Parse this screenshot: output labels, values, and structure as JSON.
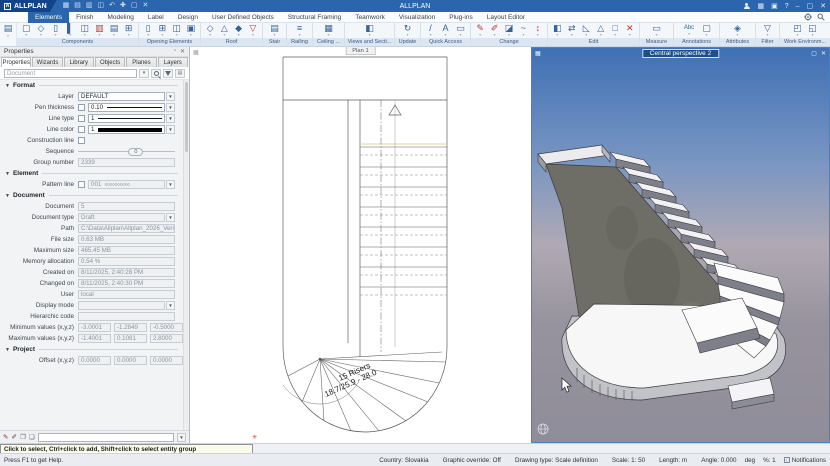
{
  "titlebar": {
    "logo_text": "ALLPLAN",
    "app_title": "ALLPLAN",
    "quick_icons": [
      "▦",
      "▤",
      "▥",
      "◫",
      "↶",
      "✚",
      "▢",
      "✕"
    ],
    "help_icon": "?",
    "window_icons": {
      "apps": "▦",
      "cart": "▣",
      "minimize": "–",
      "restore": "▢",
      "close": "✕"
    },
    "settings_icon": "✱",
    "search_icon": "⌕"
  },
  "menubar": {
    "tabs": [
      "Elements",
      "Finish",
      "Modeling",
      "Label",
      "Design",
      "User Defined Objects",
      "Structural Framing",
      "Teamwork",
      "Visualization",
      "Plug-ins",
      "Layout Editor"
    ],
    "active_tab": "Elements"
  },
  "ribbon": {
    "palette_icon": "▤",
    "groups": [
      {
        "label": "Components",
        "glyphs": [
          "▢",
          "◇",
          "▯",
          "▌",
          "◫",
          "▥",
          "▤",
          "⊞"
        ]
      },
      {
        "label": "Opening Elements",
        "glyphs": [
          "▯",
          "⊞",
          "◫",
          "▣"
        ]
      },
      {
        "label": "Roof",
        "glyphs": [
          "◇",
          "△",
          "◆",
          "▽"
        ]
      },
      {
        "label": "Stair",
        "glyphs": [
          "▤"
        ]
      },
      {
        "label": "Railing",
        "glyphs": [
          "≡"
        ]
      },
      {
        "label": "Ceiling ...",
        "glyphs": [
          "▦"
        ]
      },
      {
        "label": "Views and Secti...",
        "glyphs": [
          "◧"
        ]
      },
      {
        "label": "Update",
        "glyphs": [
          "↻"
        ]
      },
      {
        "label": "Quick Access",
        "glyphs": [
          "/",
          "A",
          "▭"
        ]
      },
      {
        "label": "Change",
        "glyphs": [
          "✎",
          "✐",
          "◪",
          "~",
          "↕"
        ]
      },
      {
        "label": "Edit",
        "glyphs": [
          "◧",
          "⇄",
          "◺",
          "△",
          "□",
          "✕"
        ]
      },
      {
        "label": "Measure",
        "glyphs": [
          "▭"
        ]
      },
      {
        "label": "Annotations",
        "glyphs": [
          "Abc",
          "▢"
        ]
      },
      {
        "label": "Attributes",
        "glyphs": [
          "◈"
        ]
      },
      {
        "label": "Filter",
        "glyphs": [
          "▽"
        ]
      },
      {
        "label": "Work Environm...",
        "glyphs": [
          "◰",
          "◱"
        ]
      }
    ]
  },
  "panel": {
    "title": "Properties",
    "pin_icon": "▫",
    "close_icon": "✕",
    "tabs": [
      "Properties",
      "Wizards",
      "Library",
      "Objects",
      "Planes",
      "Layers"
    ],
    "filter_placeholder": "Document",
    "sections": {
      "format": "Format",
      "element": "Element",
      "document": "Document",
      "project": "Project"
    },
    "format": {
      "layer_label": "Layer",
      "layer_value": "DEFAULT",
      "pen_label": "Pen thickness",
      "pen_value": "0.10",
      "linetype_label": "Line type",
      "linetype_value": "1",
      "linecolor_label": "Line color",
      "linecolor_value": "1",
      "linecolor_hex": "#000000",
      "construction_label": "Construction line",
      "sequence_label": "Sequence",
      "sequence_value": "0",
      "groupnumber_label": "Group number",
      "groupnumber_value": "2339"
    },
    "element": {
      "pattern_label": "Pattern line",
      "pattern_value": "001",
      "pattern_preview": "○○○○○○○○○○"
    },
    "document": {
      "rows": [
        {
          "label": "Document",
          "value": "5"
        },
        {
          "label": "Document type",
          "value": "Draft"
        },
        {
          "label": "Path",
          "value": "C:\\Data\\Allplan\\Allplan_2026_Verificatio"
        },
        {
          "label": "File size",
          "value": "0.63 MB"
        },
        {
          "label": "Maximum size",
          "value": "465.45 MB"
        },
        {
          "label": "Memory allocation",
          "value": "0.54 %"
        },
        {
          "label": "Created on",
          "value": "8/11/2025, 2:40:28 PM"
        },
        {
          "label": "Changed on",
          "value": "8/11/2025, 2:40:30 PM"
        },
        {
          "label": "User",
          "value": "local"
        },
        {
          "label": "Display mode",
          "value": ""
        },
        {
          "label": "Hierarchic code",
          "value": ""
        }
      ],
      "min_label": "Minimum values (x,y,z)",
      "min": [
        "-3.0001",
        "-1.2849",
        "-0.5000"
      ],
      "max_label": "Maximum values (x,y,z)",
      "max": [
        "-1.4001",
        "0.1081",
        "2.8000"
      ]
    },
    "project": {
      "offset_label": "Offset (x,y,z)",
      "offset": [
        "0.0000",
        "0.0000",
        "0.0000"
      ]
    }
  },
  "plan_view": {
    "tab": "Plan 1",
    "risers_text": "15 Risers",
    "dimensions_text": "18.7/25.9 - 28.0"
  },
  "view_3d": {
    "tab": "Central perspective 2"
  },
  "prompt": {
    "message": "Click to select, Ctrl+click to add, Shift+click to select entity group"
  },
  "statusbar": {
    "help": "Press F1 to get Help.",
    "country": "Country: Slovakia",
    "graphic_override": "Graphic override: Off",
    "drawing_type": "Drawing type: Scale definition",
    "scale": "Scale: 1: 50",
    "length": "Length: m",
    "angle": "Angle: 0.000",
    "angle_unit": "deg",
    "percent": "%: 1",
    "notifications": "Notifications"
  },
  "colors": {
    "accent_blue": "#2a65ad",
    "sky_top": "#3f70b5",
    "concrete": "#6f6e66",
    "line_color_swatch": "#000000"
  }
}
